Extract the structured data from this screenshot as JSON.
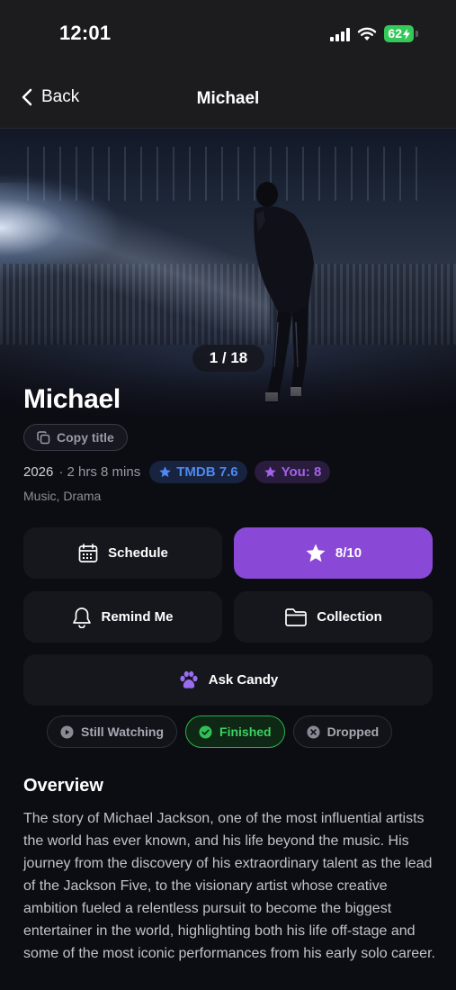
{
  "status_bar": {
    "time": "12:01",
    "battery": "62"
  },
  "nav": {
    "back_label": "Back",
    "title": "Michael"
  },
  "hero": {
    "pager": "1 / 18"
  },
  "movie": {
    "title": "Michael",
    "copy_title_label": "Copy title",
    "year": "2026",
    "runtime": "· 2 hrs 8 mins",
    "tmdb_rating": "TMDB 7.6",
    "user_rating": "You: 8",
    "genres": "Music, Drama"
  },
  "actions": {
    "schedule_label": "Schedule",
    "rating_label": "8/10",
    "remind_label": "Remind Me",
    "collection_label": "Collection",
    "ask_label": "Ask Candy"
  },
  "watch_status": {
    "options": [
      "Still Watching",
      "Finished",
      "Dropped"
    ],
    "selected": "Finished"
  },
  "overview": {
    "heading": "Overview",
    "text": "The story of Michael Jackson, one of the most influential artists the world has ever known, and his life beyond the music. His journey from the discovery of his extraordinary talent as the lead of the Jackson Five, to the visionary artist whose creative ambition fueled a relentless pursuit to become the biggest entertainer in the world, highlighting both his life off-stage and some of the most iconic performances from his early solo career."
  },
  "colors": {
    "accent_purple": "#8a48d6",
    "tmdb_blue": "#4f88f0",
    "finished_green": "#3ad061",
    "battery_green": "#34c759"
  }
}
